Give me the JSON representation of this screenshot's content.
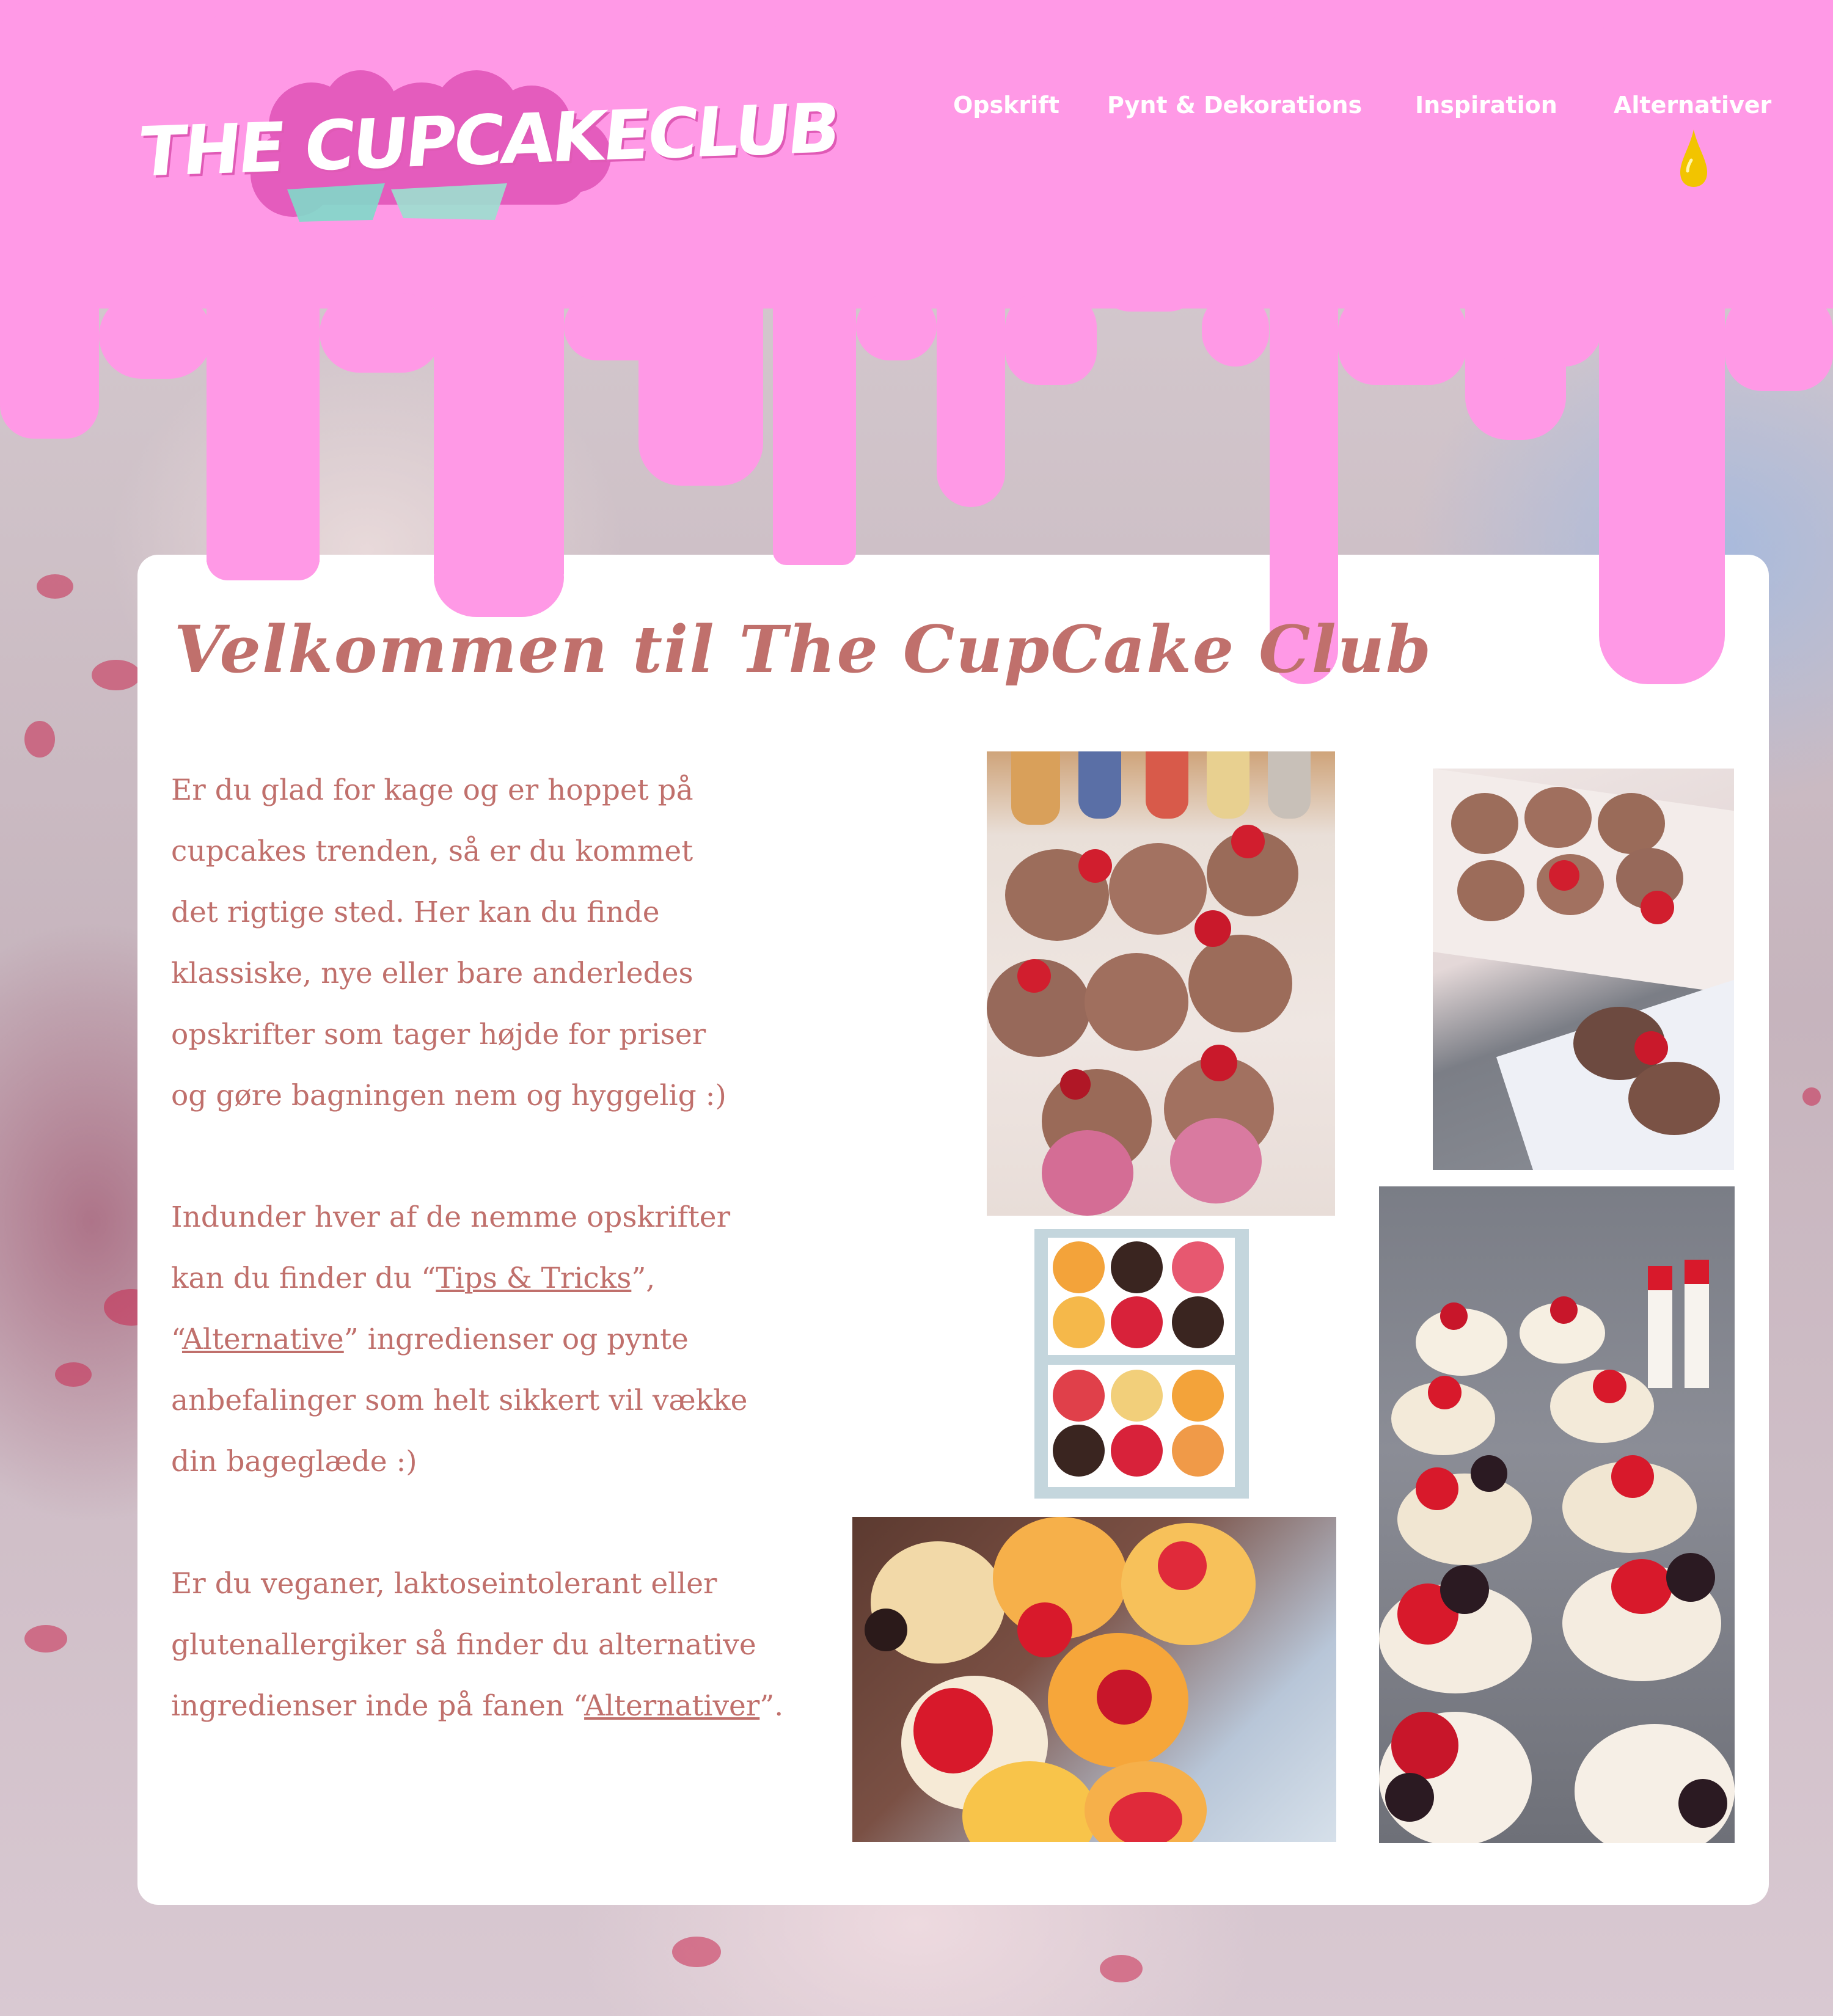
{
  "brand": {
    "logo_text": "THE CUPCAKECLUB",
    "colors": {
      "header_pink": "#ff99e6",
      "text_rose": "#c0706c",
      "card": "#ffffff",
      "accent_gold": "#f2c400"
    }
  },
  "nav": {
    "items": [
      {
        "label": "Opskrift"
      },
      {
        "label": "Pynt & Dekorations"
      },
      {
        "label": "Inspiration"
      },
      {
        "label": "Alternativer"
      }
    ],
    "active_icon": "drop-icon"
  },
  "main": {
    "title": "Velkommen til The CupCake Club",
    "paragraph1": [
      "Er du glad for kage og er hoppet på",
      "cupcakes trenden, så er du kommet",
      "det rigtige sted. Her kan du finde",
      "klassiske, nye eller bare anderledes",
      "opskrifter som tager højde for priser",
      "og gøre bagningen nem og hyggelig :)"
    ],
    "paragraph2": {
      "line1": "Indunder hver af  de nemme opskrifter",
      "line2_pre": "kan du finder du “",
      "link_tips": "Tips & Tricks",
      "line2_post": "”,",
      "line3_pre": "“",
      "link_alternative": "Alternative",
      "line3_post": "”  ingredienser og  pynte",
      "line4": "anbefalinger som helt sikkert vil vække",
      "line5": "din bageglæde :)"
    },
    "paragraph3": {
      "line1": "Er du veganer, laktoseintolerant eller",
      "line2": "glutenallergiker så finder du alternative",
      "line3_pre": "ingredienser inde på fanen “",
      "link_alternativer": "Alternativer",
      "line3_post": "”."
    }
  },
  "photos": [
    {
      "name": "photo-chocolate-cupcakes"
    },
    {
      "name": "photo-cupcakes-in-box"
    },
    {
      "name": "photo-cupcake-box-top"
    },
    {
      "name": "photo-fruit-cupcakes"
    },
    {
      "name": "photo-dessert-cups"
    }
  ]
}
